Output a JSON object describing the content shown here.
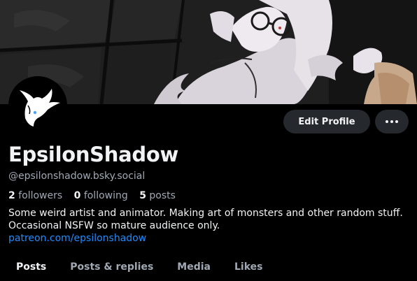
{
  "profile": {
    "display_name": "EpsilonShadow",
    "handle": "@epsilonshadow.bsky.social",
    "followers_count": "2",
    "followers_label": "followers",
    "following_count": "0",
    "following_label": "following",
    "posts_count": "5",
    "posts_label": "posts",
    "bio_line1": "Some weird artist and animator. Making art of monsters and other random stuff.",
    "bio_line2": "Occasional NSFW so mature audience only.",
    "bio_link": "patreon.com/epsilonshadow"
  },
  "actions": {
    "edit_profile_label": "Edit Profile",
    "more_icon": "ellipsis-icon"
  },
  "tabs": [
    {
      "label": "Posts",
      "active": true
    },
    {
      "label": "Posts & replies",
      "active": false
    },
    {
      "label": "Media",
      "active": false
    },
    {
      "label": "Likes",
      "active": false
    }
  ],
  "colors": {
    "background": "#000000",
    "button_bg": "#25282d",
    "text_primary": "#f1f3f5",
    "text_secondary": "#a0a8b3",
    "link": "#208bfe"
  }
}
